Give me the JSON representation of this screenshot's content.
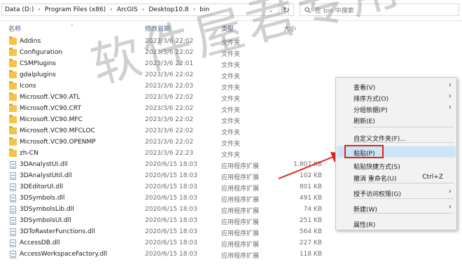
{
  "address": {
    "crumbs": [
      "Data (D:)",
      "Program Files (x86)",
      "ArcGIS",
      "Desktop10.8",
      "bin"
    ],
    "separator": "›"
  },
  "search": {
    "placeholder": "在 bin 中搜索"
  },
  "columns": {
    "name": "名称",
    "modified": "修改日期",
    "type": "类型",
    "size": "大小"
  },
  "files": [
    {
      "name": "Addins",
      "date": "2023/3/6 22:02",
      "type": "文件夹",
      "size": "",
      "kind": "folder"
    },
    {
      "name": "Configuration",
      "date": "2023/3/6 22:02",
      "type": "文件夹",
      "size": "",
      "kind": "folder"
    },
    {
      "name": "CSMPlugins",
      "date": "2023/3/6 22:01",
      "type": "文件夹",
      "size": "",
      "kind": "folder"
    },
    {
      "name": "gdalplugins",
      "date": "2023/3/6 22:02",
      "type": "文件夹",
      "size": "",
      "kind": "folder"
    },
    {
      "name": "Icons",
      "date": "2023/3/6 22:03",
      "type": "文件夹",
      "size": "",
      "kind": "folder"
    },
    {
      "name": "Microsoft.VC90.ATL",
      "date": "2023/3/6 22:02",
      "type": "文件夹",
      "size": "",
      "kind": "folder"
    },
    {
      "name": "Microsoft.VC90.CRT",
      "date": "2023/3/6 22:02",
      "type": "文件夹",
      "size": "",
      "kind": "folder"
    },
    {
      "name": "Microsoft.VC90.MFC",
      "date": "2023/3/6 22:02",
      "type": "文件夹",
      "size": "",
      "kind": "folder"
    },
    {
      "name": "Microsoft.VC90.MFCLOC",
      "date": "2023/3/6 22:02",
      "type": "文件夹",
      "size": "",
      "kind": "folder"
    },
    {
      "name": "Microsoft.VC90.OPENMP",
      "date": "2023/3/6 22:02",
      "type": "文件夹",
      "size": "",
      "kind": "folder"
    },
    {
      "name": "zh-CN",
      "date": "2023/3/6 22:23",
      "type": "文件夹",
      "size": "",
      "kind": "folder"
    },
    {
      "name": "3DAnalystUI.dll",
      "date": "2020/6/15 18:03",
      "type": "应用程序扩展",
      "size": "1,807 KB",
      "kind": "dll"
    },
    {
      "name": "3DAnalystUtil.dll",
      "date": "2020/6/15 18:03",
      "type": "应用程序扩展",
      "size": "102 KB",
      "kind": "dll"
    },
    {
      "name": "3DEditorUI.dll",
      "date": "2020/6/15 18:03",
      "type": "应用程序扩展",
      "size": "801 KB",
      "kind": "dll"
    },
    {
      "name": "3DSymbols.dll",
      "date": "2020/6/15 18:03",
      "type": "应用程序扩展",
      "size": "491 KB",
      "kind": "dll"
    },
    {
      "name": "3DSymbolsLib.dll",
      "date": "2020/6/15 18:03",
      "type": "应用程序扩展",
      "size": "74 KB",
      "kind": "dll"
    },
    {
      "name": "3DSymbolsUI.dll",
      "date": "2020/6/15 18:03",
      "type": "应用程序扩展",
      "size": "251 KB",
      "kind": "dll"
    },
    {
      "name": "3DToRasterFunctions.dll",
      "date": "2020/6/15 18:03",
      "type": "应用程序扩展",
      "size": "564 KB",
      "kind": "dll"
    },
    {
      "name": "AccessDB.dll",
      "date": "2020/6/15 18:03",
      "type": "应用程序扩展",
      "size": "227 KB",
      "kind": "dll"
    },
    {
      "name": "AccessWorkspaceFactory.dll",
      "date": "2020/6/15 18:03",
      "type": "应用程序扩展",
      "size": "118 KB",
      "kind": "dll"
    }
  ],
  "watermark": "软件屋君专用",
  "context_menu": {
    "items": [
      {
        "label": "查看(V)",
        "shortcut": "",
        "submenu": true
      },
      {
        "label": "排序方式(O)",
        "shortcut": "",
        "submenu": true
      },
      {
        "label": "分组依据(P)",
        "shortcut": "",
        "submenu": true
      },
      {
        "label": "刷新(E)",
        "shortcut": "",
        "submenu": false
      },
      {
        "label": "自定义文件夹(F)...",
        "shortcut": "",
        "submenu": false
      },
      {
        "label": "粘贴(P)",
        "shortcut": "",
        "submenu": false
      },
      {
        "label": "粘贴快捷方式(S)",
        "shortcut": "",
        "submenu": false
      },
      {
        "label": "撤消 重命名(U)",
        "shortcut": "Ctrl+Z",
        "submenu": false
      },
      {
        "label": "授予访问权限(G)",
        "shortcut": "",
        "submenu": true
      },
      {
        "label": "新建(W)",
        "shortcut": "",
        "submenu": true
      },
      {
        "label": "属性(R)",
        "shortcut": "",
        "submenu": false
      }
    ],
    "highlighted": "粘贴(P)"
  },
  "colors": {
    "highlight_box": "#e2231a",
    "folder": "#f3c34a",
    "header_text": "#4d6082"
  }
}
